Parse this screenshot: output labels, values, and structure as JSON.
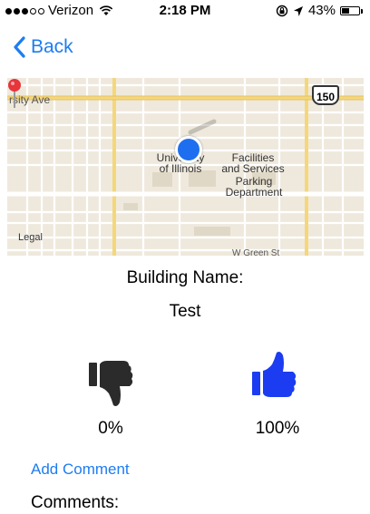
{
  "status_bar": {
    "carrier": "Verizon",
    "time": "2:18 PM",
    "battery_text": "43%",
    "battery_level": 0.43
  },
  "nav": {
    "back_label": "Back"
  },
  "map": {
    "street_label": "rsity Ave",
    "route_shield": "150",
    "place_1_line1": "University",
    "place_1_line2": "of Illinois",
    "place_2_line1": "Facilities",
    "place_2_line2": "and Services",
    "place_3_line1": "Parking",
    "place_3_line2": "Department",
    "legal": "Legal",
    "bottom_street": "W Green St"
  },
  "building": {
    "name_label": "Building Name:",
    "name_value": "Test"
  },
  "votes": {
    "down_percent": "0%",
    "up_percent": "100%"
  },
  "comments": {
    "add_label": "Add Comment",
    "header": "Comments:"
  },
  "colors": {
    "accent": "#1e7cf2",
    "thumb_up": "#1c3cf2",
    "thumb_down": "#2b2b2b"
  }
}
